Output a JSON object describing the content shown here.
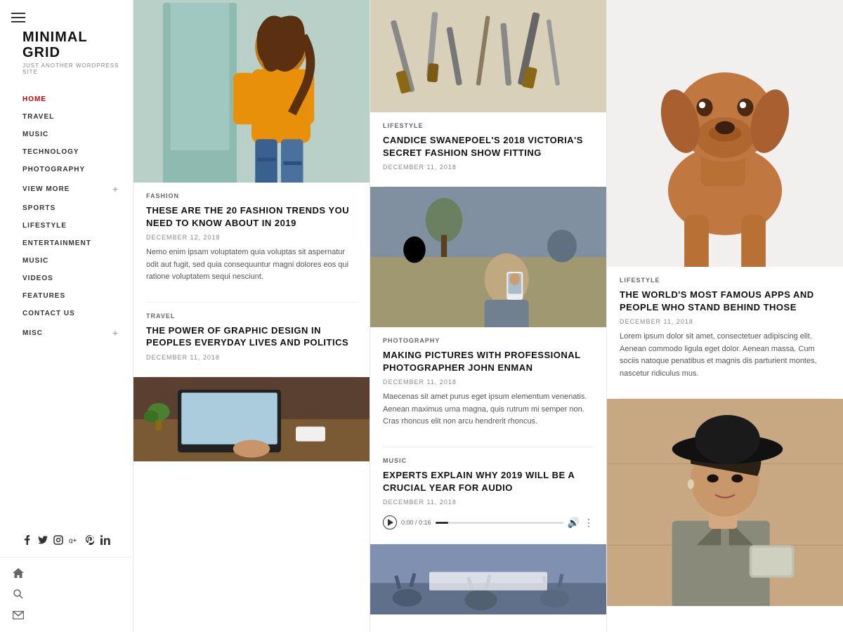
{
  "sidebar": {
    "logo": {
      "title": "MINIMAL\nGRID",
      "subtitle": "JUST ANOTHER WORDPRESS SITE"
    },
    "nav": [
      {
        "label": "HOME",
        "active": true,
        "hasPlus": false
      },
      {
        "label": "TRAVEL",
        "active": false,
        "hasPlus": false
      },
      {
        "label": "MUSIC",
        "active": false,
        "hasPlus": false
      },
      {
        "label": "TECHNOLOGY",
        "active": false,
        "hasPlus": false
      },
      {
        "label": "PHOTOGRAPHY",
        "active": false,
        "hasPlus": false
      },
      {
        "label": "VIEW MORE",
        "active": false,
        "hasPlus": true
      },
      {
        "label": "SPORTS",
        "active": false,
        "hasPlus": false
      },
      {
        "label": "LIFESTYLE",
        "active": false,
        "hasPlus": false
      },
      {
        "label": "ENTERTAINMENT",
        "active": false,
        "hasPlus": false
      },
      {
        "label": "MUSIC",
        "active": false,
        "hasPlus": false
      },
      {
        "label": "VIDEOS",
        "active": false,
        "hasPlus": false
      },
      {
        "label": "FEATURES",
        "active": false,
        "hasPlus": false
      },
      {
        "label": "CONTACT US",
        "active": false,
        "hasPlus": false
      },
      {
        "label": "MISC",
        "active": false,
        "hasPlus": true
      }
    ],
    "social": [
      "f",
      "t",
      "in",
      "g+",
      "p",
      "li"
    ]
  },
  "columns": {
    "col1": {
      "articles": [
        {
          "category": "FASHION",
          "title": "THESE ARE THE 20 FASHION TRENDS YOU NEED TO KNOW ABOUT IN 2019",
          "date": "DECEMBER 12, 2018",
          "excerpt": "Nemo enim ipsam voluptatem quia voluptas sit aspernatur odit aut fugit, sed quia consequuntur magni dolores eos qui ratione voluptatem sequi nesciunt.",
          "hasImage": true,
          "imageType": "fashion"
        },
        {
          "category": "TRAVEL",
          "title": "THE POWER OF GRAPHIC DESIGN IN PEOPLES EVERYDAY LIVES AND POLITICS",
          "date": "DECEMBER 11, 2018",
          "excerpt": "",
          "hasImage": false,
          "imageType": null
        },
        {
          "category": "",
          "title": "",
          "date": "",
          "excerpt": "",
          "hasImage": true,
          "imageType": "laptop"
        }
      ]
    },
    "col2": {
      "articles": [
        {
          "category": "LIFESTYLE",
          "title": "CANDICE SWANEPOEL'S 2018 VICTORIA'S SECRET FASHION SHOW FITTING",
          "date": "DECEMBER 11, 2018",
          "excerpt": "",
          "hasImage": true,
          "imageType": "tools"
        },
        {
          "category": "PHOTOGRAPHY",
          "title": "MAKING PICTURES WITH PROFESSIONAL PHOTOGRAPHER JOHN ENMAN",
          "date": "DECEMBER 11, 2018",
          "excerpt": "Maecenas sit amet purus eget ipsum elementum venenatis. Aenean maximus urna magna, quis rutrum mi semper non. Cras rhoncus elit non arcu hendrerit rhoncus.",
          "hasImage": true,
          "imageType": "cafe"
        },
        {
          "category": "MUSIC",
          "title": "EXPERTS EXPLAIN WHY 2019 WILL BE A CRUCIAL YEAR FOR AUDIO",
          "date": "DECEMBER 11, 2018",
          "excerpt": "",
          "hasImage": false,
          "imageType": null,
          "hasAudio": true,
          "audioTime": "0:00 / 0:16"
        },
        {
          "category": "",
          "title": "",
          "date": "",
          "excerpt": "",
          "hasImage": true,
          "imageType": "concert"
        }
      ]
    },
    "col3": {
      "articles": [
        {
          "category": "LIFESTYLE",
          "title": "THE WORLD'S MOST FAMOUS APPS AND PEOPLE WHO STAND BEHIND THOSE",
          "date": "DECEMBER 11, 2018",
          "excerpt": "Lorem ipsum dolor sit amet, consectetuer adipiscing elit. Aenean commodo ligula eget dolor. Aenean massa. Cum sociis natoque penatibus et magnis dis parturient montes, nascetur ridiculus mus.",
          "hasImage": true,
          "imageType": "dog"
        },
        {
          "category": "",
          "title": "",
          "date": "",
          "excerpt": "",
          "hasImage": true,
          "imageType": "woman-hat"
        }
      ]
    }
  }
}
